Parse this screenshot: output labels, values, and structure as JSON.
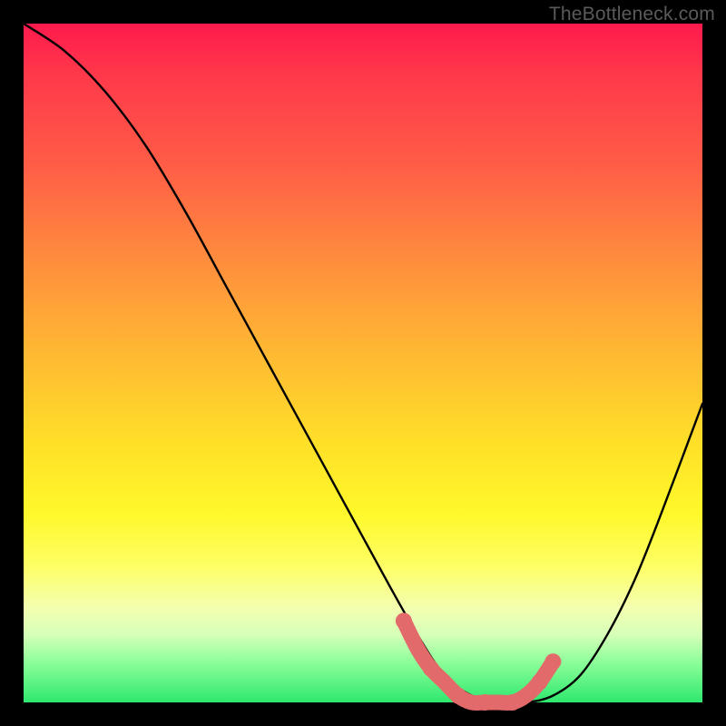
{
  "watermark": "TheBottleneck.com",
  "chart_data": {
    "type": "line",
    "title": "",
    "xlabel": "",
    "ylabel": "",
    "xlim": [
      0,
      100
    ],
    "ylim": [
      0,
      100
    ],
    "series": [
      {
        "name": "bottleneck-curve",
        "x": [
          0,
          6,
          12,
          18,
          24,
          30,
          36,
          42,
          48,
          54,
          58,
          62,
          66,
          70,
          74,
          78,
          82,
          86,
          90,
          94,
          100
        ],
        "values": [
          100,
          96,
          90,
          82,
          72,
          61,
          50,
          39,
          28,
          17,
          10,
          4,
          1,
          0,
          0,
          1,
          4,
          10,
          18,
          28,
          44
        ]
      }
    ],
    "markers": {
      "name": "highlighted-range",
      "color": "#e26a6a",
      "x": [
        56,
        58,
        60,
        62,
        64,
        66,
        68,
        70,
        72,
        74,
        76,
        78
      ],
      "values": [
        12,
        8,
        5,
        3,
        1,
        0,
        0,
        0,
        0,
        1,
        3,
        6
      ]
    }
  }
}
